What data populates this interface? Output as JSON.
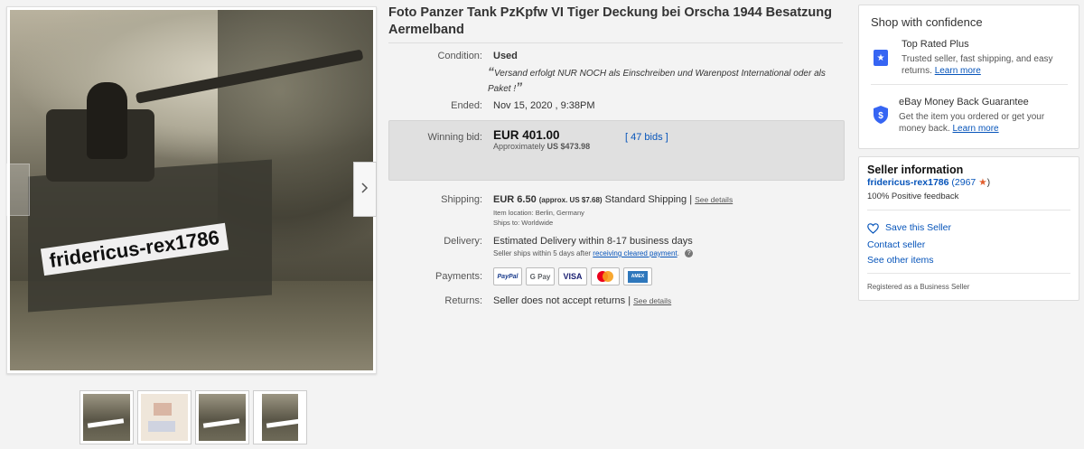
{
  "listing": {
    "title": "Foto Panzer Tank PzKpfw VI Tiger Deckung bei Orscha 1944 Besatzung Aermelband",
    "watermark": "fridericus-rex1786"
  },
  "details": {
    "condition_label": "Condition:",
    "condition_value": "Used",
    "condition_quote": "Versand erfolgt NUR NOCH als Einschreiben und Warenpost International oder als Paket !",
    "ended_label": "Ended:",
    "ended_value": "Nov 15, 2020 , 9:38PM",
    "winning_bid_label": "Winning bid:",
    "winning_bid_value": "EUR 401.00",
    "approx_prefix": "Approximately",
    "approx_value": "US $473.98",
    "bids_link": "47 bids",
    "shipping_label": "Shipping:",
    "shipping_value": "EUR 6.50",
    "shipping_approx": "(approx. US $7.68)",
    "shipping_method": "Standard Shipping |",
    "shipping_details_link": "See details",
    "item_location": "Item location:  Berlin, Germany",
    "ships_to": "Ships to:  Worldwide",
    "delivery_label": "Delivery:",
    "delivery_value": "Estimated Delivery within 8-17 business days",
    "delivery_note_prefix": "Seller ships within 5 days after",
    "delivery_note_link": "receiving cleared payment",
    "delivery_note_suffix": ".",
    "payments_label": "Payments:",
    "payment_methods": [
      "PayPal",
      "G Pay",
      "VISA",
      "Mastercard",
      "American Express"
    ],
    "returns_label": "Returns:",
    "returns_value": "Seller does not accept returns |",
    "returns_details_link": "See details"
  },
  "shop_confidence": {
    "heading": "Shop with confidence",
    "top_rated_title": "Top Rated Plus",
    "top_rated_text": "Trusted seller, fast shipping, and easy returns.",
    "top_rated_link": "Learn more",
    "guarantee_title": "eBay Money Back Guarantee",
    "guarantee_text": "Get the item you ordered or get your money back.",
    "guarantee_link": "Learn more"
  },
  "seller": {
    "heading": "Seller information",
    "name": "fridericus-rex1786",
    "feedback_score": "(2967",
    "feedback_score_close": ")",
    "positive": "100% Positive feedback",
    "save_seller": "Save this Seller",
    "contact": "Contact seller",
    "other_items": "See other items",
    "registered": "Registered as a Business Seller"
  },
  "icons": {
    "next": "chevron-right-icon",
    "top_rated": "ribbon-star-icon",
    "guarantee": "shield-dollar-icon",
    "heart": "heart-icon",
    "star": "star-icon",
    "info": "info-icon"
  },
  "colors": {
    "link": "#0654ba",
    "accent": "#3665f3",
    "star": "#e25d2b"
  }
}
